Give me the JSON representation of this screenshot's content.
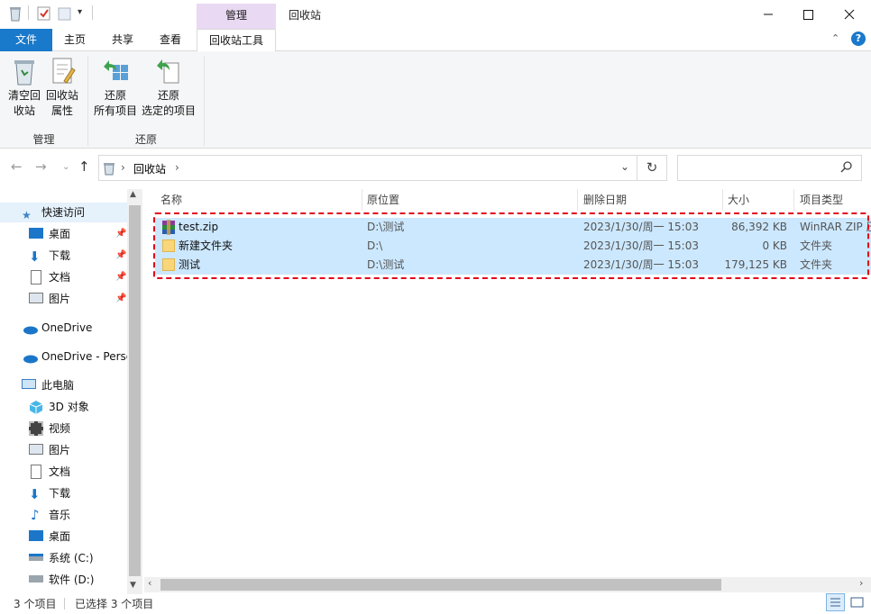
{
  "window": {
    "title": "回收站",
    "context_tab_header": "管理"
  },
  "ribbon_tabs": {
    "file": "文件",
    "home": "主页",
    "share": "共享",
    "view": "查看",
    "recycle_tools": "回收站工具"
  },
  "ribbon": {
    "empty_line1": "清空回",
    "empty_line2": "收站",
    "props_line1": "回收站",
    "props_line2": "属性",
    "restore_all_line1": "还原",
    "restore_all_line2": "所有项目",
    "restore_sel_line1": "还原",
    "restore_sel_line2": "选定的项目",
    "group_manage": "管理",
    "group_restore": "还原"
  },
  "address": {
    "location": "回收站",
    "search_placeholder": ""
  },
  "nav": {
    "quick_access": "快速访问",
    "desktop": "桌面",
    "downloads": "下载",
    "documents": "文档",
    "pictures": "图片",
    "onedrive": "OneDrive",
    "onedrive_personal": "OneDrive - Personal",
    "this_pc": "此电脑",
    "objects3d": "3D 对象",
    "videos": "视频",
    "pictures2": "图片",
    "documents2": "文档",
    "downloads2": "下载",
    "music": "音乐",
    "desktop2": "桌面",
    "drive_c": "系统 (C:)",
    "drive_d": "软件 (D:)"
  },
  "columns": {
    "name": "名称",
    "location": "原位置",
    "deleted": "删除日期",
    "size": "大小",
    "type": "项目类型"
  },
  "files": [
    {
      "name": "test.zip",
      "location": "D:\\测试",
      "deleted": "2023/1/30/周一 15:03",
      "size": "86,392 KB",
      "type": "WinRAR ZIP 压"
    },
    {
      "name": "新建文件夹",
      "location": "D:\\",
      "deleted": "2023/1/30/周一 15:03",
      "size": "0 KB",
      "type": "文件夹"
    },
    {
      "name": "测试",
      "location": "D:\\测试",
      "deleted": "2023/1/30/周一 15:03",
      "size": "179,125 KB",
      "type": "文件夹"
    }
  ],
  "status": {
    "count": "3 个项目",
    "selected": "已选择 3 个项目"
  },
  "colors": {
    "accent": "#1979ca",
    "selection": "#cce8ff",
    "highlight_border": "#e0001b",
    "context_tab": "#e9d9f3"
  }
}
